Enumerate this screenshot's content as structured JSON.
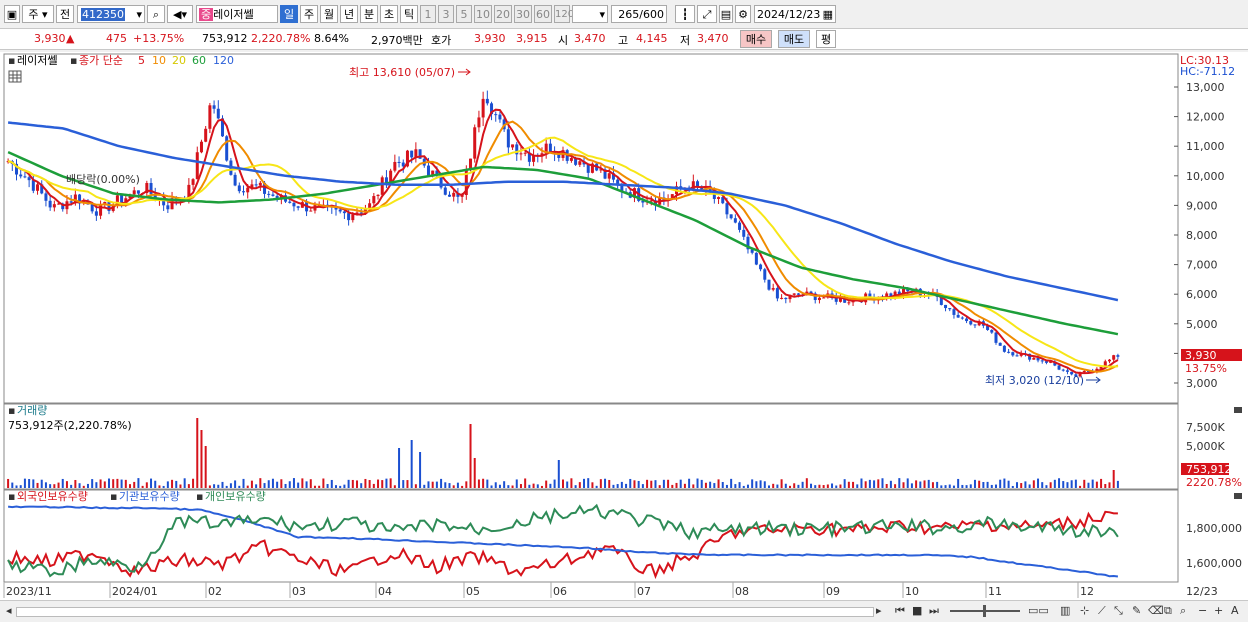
{
  "toolbar": {
    "market": "주",
    "type": "전",
    "code": "412350",
    "badge": "중",
    "name": "레이저쎌",
    "periods": [
      "일",
      "주",
      "월",
      "년",
      "분",
      "초",
      "틱"
    ],
    "active_period": "일",
    "minutes": [
      "1",
      "3",
      "5",
      "10",
      "20",
      "30",
      "60",
      "120"
    ],
    "count": "265",
    "count_total": "/600",
    "date": "2024/12/23"
  },
  "quote": {
    "price": "3,930",
    "change_arrow": "▲",
    "change": "475",
    "change_pct": "+13.75%",
    "volume": "753,912",
    "volume_ratio": "2,220.78%",
    "turnover": "8.64%",
    "amount": "2,970백만",
    "bid_label": "호가",
    "ask": "3,930",
    "bid": "3,915",
    "open_label": "시",
    "open": "3,470",
    "high_label": "고",
    "high": "4,145",
    "low_label": "저",
    "low": "3,470",
    "buy_button": "매수",
    "sell_button": "매도",
    "eval_button": "평"
  },
  "price_panel": {
    "stock_name": "레이저쎌",
    "ma_label": "종가 단순",
    "ma_periods": [
      "5",
      "10",
      "20",
      "60",
      "120"
    ],
    "ma_colors": [
      "#d6131b",
      "#f08c00",
      "#f7e617",
      "#1d9e3a",
      "#2a5fd8"
    ],
    "lc": "LC:30.13",
    "hc": "HC:-71.12",
    "high_note": "최고 13,610 (05/07)",
    "low_note": "최저 3,020 (12/10)",
    "dividend_note": "배당락(0.00%)",
    "last_price": "3,930",
    "last_pct": "13.75%"
  },
  "volume_panel": {
    "title": "거래량",
    "value": "753,912주(2,220.78%)",
    "last_volume": "753,912",
    "last_ratio": "2220.78%"
  },
  "holding_panel": {
    "series": [
      {
        "name": "외국인보유수량",
        "color": "#d6131b"
      },
      {
        "name": "기관보유수량",
        "color": "#2a5fd8"
      },
      {
        "name": "개인보유수량",
        "color": "#2e8b57"
      }
    ]
  },
  "chart_data": {
    "type": "line",
    "x": [
      "2023/11",
      "2024/01",
      "02",
      "03",
      "04",
      "05",
      "06",
      "07",
      "08",
      "09",
      "10",
      "11",
      "12",
      "12/23"
    ],
    "price_axis": {
      "ticks": [
        3000,
        4000,
        5000,
        6000,
        7000,
        8000,
        9000,
        10000,
        11000,
        12000,
        13000
      ],
      "tick_labels": [
        "3,000",
        "4,000",
        "5,000",
        "6,000",
        "7,000",
        "8,000",
        "9,000",
        "10,000",
        "11,000",
        "12,000",
        "13,000"
      ]
    },
    "volume_axis": {
      "tick_labels": [
        "5,000K",
        "7,500K"
      ]
    },
    "holding_axis": {
      "tick_labels": [
        "1,600,000",
        "1,800,000"
      ]
    },
    "close_approx": [
      10500,
      9800,
      8900,
      9300,
      8800,
      9200,
      9600,
      9000,
      9500,
      12600,
      9700,
      9600,
      9200,
      9000,
      8800,
      8700,
      9000,
      10400,
      10700,
      9800,
      9100,
      13000,
      11200,
      10700,
      11000,
      10600,
      10200,
      9600,
      9300,
      9200,
      9700,
      9400,
      8500,
      7000,
      5800,
      6000,
      5900,
      5800,
      5900,
      6000,
      6100,
      5900,
      5200,
      5000,
      4100,
      3900,
      3700,
      3200,
      3500,
      3930
    ],
    "ma120_approx": [
      11800,
      11600,
      11000,
      10600,
      10300,
      10000,
      9800,
      9700,
      9700,
      9800,
      9800,
      9700,
      9600,
      9400,
      9000,
      8400,
      7700,
      7100,
      6600,
      6200,
      5800
    ],
    "ma60_approx": [
      10800,
      10000,
      9400,
      9200,
      9100,
      9200,
      9400,
      9700,
      10000,
      10300,
      10200,
      9900,
      9200,
      8500,
      7600,
      6900,
      6500,
      6200,
      5800,
      5400,
      5000,
      4650
    ]
  }
}
